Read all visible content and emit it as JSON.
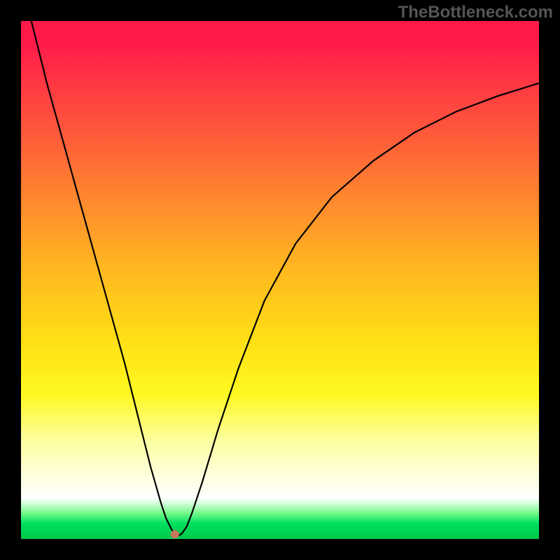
{
  "watermark": "TheBottleneck.com",
  "chart_data": {
    "type": "line",
    "title": "",
    "xlabel": "",
    "ylabel": "",
    "xlim": [
      0,
      100
    ],
    "ylim": [
      0,
      100
    ],
    "series": [
      {
        "name": "curve",
        "x": [
          2,
          5,
          10,
          15,
          20,
          23,
          25,
          27,
          28,
          29,
          29.7,
          30,
          30.5,
          31,
          32,
          33,
          35,
          38,
          42,
          47,
          53,
          60,
          68,
          76,
          84,
          92,
          100
        ],
        "y": [
          100,
          88,
          70,
          52,
          34,
          22,
          14,
          7,
          4,
          2,
          0.9,
          0.6,
          0.7,
          1,
          2.4,
          5,
          11,
          21,
          33,
          46,
          57,
          66,
          73,
          78.5,
          82.5,
          85.5,
          88
        ]
      }
    ],
    "marker": {
      "x": 29.7,
      "y": 0.9
    },
    "background_gradient": {
      "stops": [
        {
          "pct": 0,
          "color": "#ff1a4a"
        },
        {
          "pct": 35,
          "color": "#ff8a2e"
        },
        {
          "pct": 62,
          "color": "#ffe015"
        },
        {
          "pct": 92,
          "color": "#ffffff"
        },
        {
          "pct": 100,
          "color": "#00c848"
        }
      ]
    }
  }
}
